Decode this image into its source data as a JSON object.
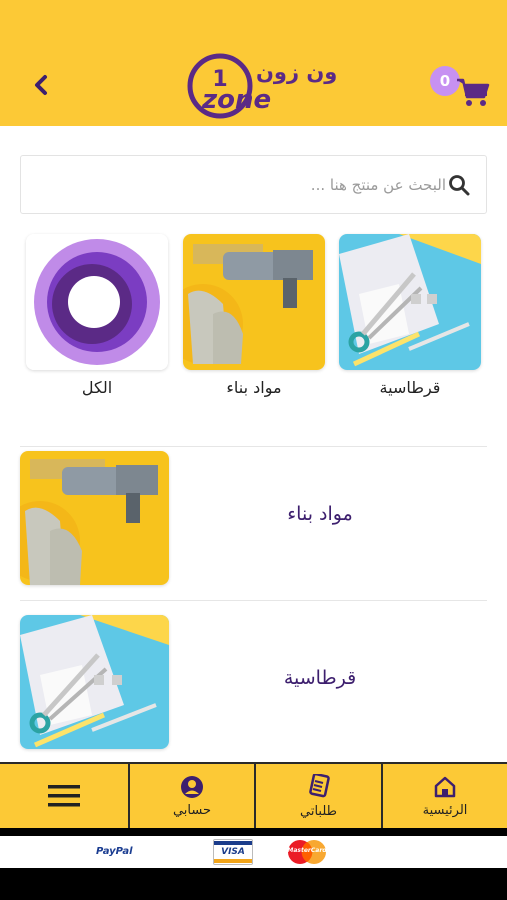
{
  "header": {
    "logo_arabic": "ون زون",
    "logo_digit": "1",
    "logo_word": "zone",
    "cart_count": "0",
    "colors": {
      "bg": "#fcc936",
      "accent": "#5b2a86",
      "badge": "#c791f2"
    }
  },
  "search": {
    "placeholder": "البحث عن منتج هنا ..."
  },
  "categories": [
    {
      "label": "قرطاسية",
      "image": "stationery-photo"
    },
    {
      "label": "مواد بناء",
      "image": "construction-tools-photo"
    },
    {
      "label": "الكل",
      "image": "all-ring-icon"
    }
  ],
  "list": [
    {
      "label": "مواد بناء",
      "image": "construction-tools-photo"
    },
    {
      "label": "قرطاسية",
      "image": "stationery-photo"
    }
  ],
  "bottom_nav": {
    "menu_icon": "hamburger-icon",
    "items": [
      {
        "label": "حسابي",
        "icon": "user-icon"
      },
      {
        "label": "طلباتي",
        "icon": "receipt-icon"
      },
      {
        "label": "الرئيسية",
        "icon": "home-icon"
      }
    ]
  },
  "payments": {
    "paypal": "PayPal",
    "visa": "VISA",
    "mastercard": "MasterCard"
  }
}
